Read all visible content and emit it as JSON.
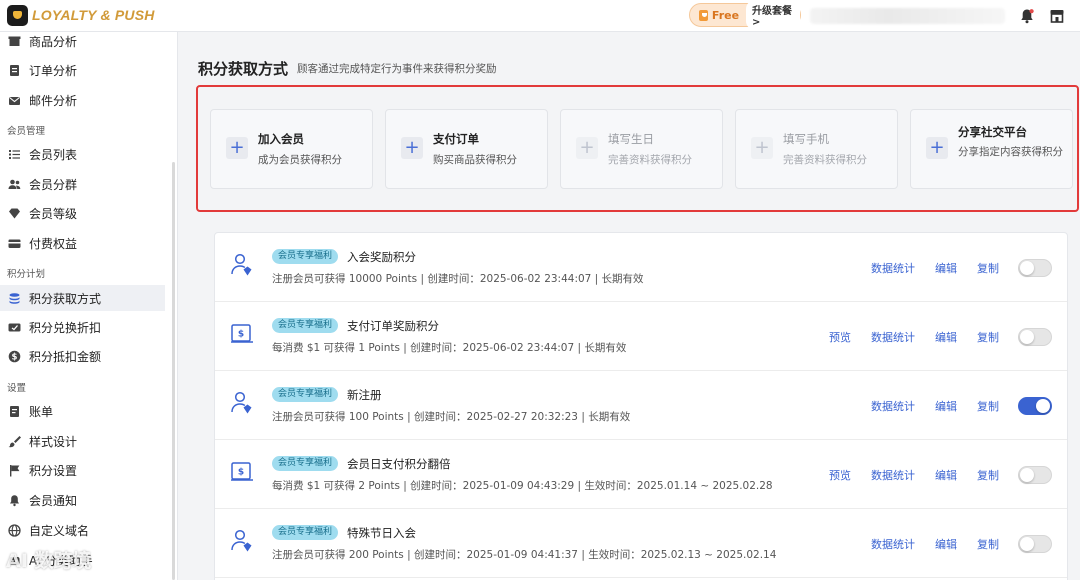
{
  "brand": "LOYALTY & PUSH",
  "plan": {
    "free_label": "Free",
    "upgrade_label": "升级套餐 >"
  },
  "sidebar": {
    "items": [
      {
        "label": "商品分析",
        "icon": "box-icon"
      },
      {
        "label": "订单分析",
        "icon": "document-icon"
      },
      {
        "label": "邮件分析",
        "icon": "mail-icon"
      },
      {
        "group": "会员管理"
      },
      {
        "label": "会员列表",
        "icon": "list-icon"
      },
      {
        "label": "会员分群",
        "icon": "users-icon"
      },
      {
        "label": "会员等级",
        "icon": "diamond-icon"
      },
      {
        "label": "付费权益",
        "icon": "card-icon"
      },
      {
        "group": "积分计划"
      },
      {
        "label": "积分获取方式",
        "icon": "coins-icon",
        "active": true
      },
      {
        "label": "积分兑换折扣",
        "icon": "ticket-icon"
      },
      {
        "label": "积分抵扣金额",
        "icon": "dollar-icon"
      },
      {
        "group": "设置"
      },
      {
        "label": "账单",
        "icon": "bill-icon"
      },
      {
        "label": "样式设计",
        "icon": "brush-icon"
      },
      {
        "label": "积分设置",
        "icon": "flag-icon"
      },
      {
        "label": "会员通知",
        "icon": "bell-icon"
      },
      {
        "label": "自定义域名",
        "icon": "globe-icon"
      },
      {
        "label": "AI 分类助手",
        "icon": "ai-icon"
      }
    ]
  },
  "main": {
    "title": "积分获取方式",
    "subtitle": "顾客通过完成特定行为事件来获得积分奖励",
    "methods": [
      {
        "title": "加入会员",
        "desc": "成为会员获得积分",
        "enabled": true
      },
      {
        "title": "支付订单",
        "desc": "购买商品获得积分",
        "enabled": true
      },
      {
        "title": "填写生日",
        "desc": "完善资料获得积分",
        "enabled": false
      },
      {
        "title": "填写手机",
        "desc": "完善资料获得积分",
        "enabled": false
      },
      {
        "title": "分享社交平台",
        "desc": "分享指定内容获得积分",
        "enabled": true
      }
    ],
    "rules": [
      {
        "badge": "会员专享福利",
        "title": "入会奖励积分",
        "desc": "注册会员可获得 10000 Points | 创建时间：2025-06-02 23:44:07 | 长期有效",
        "icon": "user-reward-icon",
        "preview": false,
        "enabled": false
      },
      {
        "badge": "会员专享福利",
        "title": "支付订单奖励积分",
        "desc": "每消费 $1 可获得 1 Points | 创建时间：2025-06-02 23:44:07 | 长期有效",
        "icon": "order-reward-icon",
        "preview": true,
        "enabled": false
      },
      {
        "badge": "会员专享福利",
        "title": "新注册",
        "desc": "注册会员可获得 100 Points | 创建时间：2025-02-27 20:32:23 | 长期有效",
        "icon": "user-reward-icon",
        "preview": false,
        "enabled": true
      },
      {
        "badge": "会员专享福利",
        "title": "会员日支付积分翻倍",
        "desc": "每消费 $1 可获得 2 Points | 创建时间：2025-01-09 04:43:29 | 生效时间：2025.01.14 ~ 2025.02.28",
        "icon": "order-reward-icon",
        "preview": true,
        "enabled": false
      },
      {
        "badge": "会员专享福利",
        "title": "特殊节日入会",
        "desc": "注册会员可获得 200 Points | 创建时间：2025-01-09 04:41:37 | 生效时间：2025.02.13 ~ 2025.02.14",
        "icon": "user-reward-icon",
        "preview": false,
        "enabled": false
      }
    ],
    "actions": {
      "preview": "预览",
      "stats": "数据统计",
      "edit": "编辑",
      "copy": "复制"
    }
  },
  "watermark": "AI 数跨境",
  "colors": {
    "accent": "#3a63d1",
    "brand": "#d19a39",
    "highlight_border": "#e23a3a",
    "badge_bg": "#9fdcef"
  }
}
